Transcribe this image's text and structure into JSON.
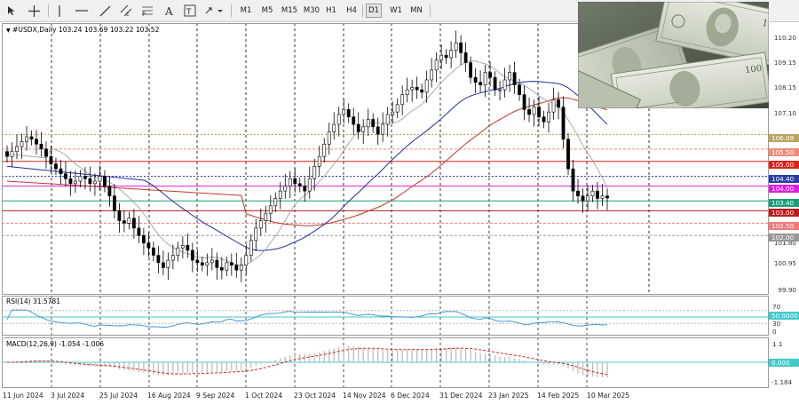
{
  "toolbar": {
    "timeframes": [
      "M1",
      "M5",
      "M15",
      "M30",
      "H1",
      "H4",
      "D1",
      "W1",
      "MN"
    ],
    "active_timeframe": "D1"
  },
  "chart": {
    "title": "#USDX,Daily  103.24 103.69 103.22 103.52",
    "symbol": "#USDX",
    "period": "Daily",
    "open": 103.24,
    "high": 103.69,
    "low": 103.22,
    "close": 103.52
  },
  "price_axis": {
    "ticks": [
      "110.20",
      "109.15",
      "108.15",
      "107.10",
      "101.80",
      "100.95",
      "99.90"
    ],
    "levels": [
      {
        "value": 106.09,
        "label": "106.09",
        "color": "#b9a55e"
      },
      {
        "value": 105.5,
        "label": "105.50",
        "color": "#f08c7c"
      },
      {
        "value": 105.0,
        "label": "105.00",
        "color": "#d9231e"
      },
      {
        "value": 104.4,
        "label": "104.40",
        "color": "#2b3fa3"
      },
      {
        "value": 104.0,
        "label": "104.00",
        "color": "#e01ee0"
      },
      {
        "value": 103.4,
        "label": "103.40",
        "color": "#1b9e77"
      },
      {
        "value": 103.0,
        "label": "103.00",
        "color": "#b81c1c"
      },
      {
        "value": 102.5,
        "label": "102.50",
        "color": "#f07a7a"
      },
      {
        "value": 102.0,
        "label": "102.00",
        "color": "#999999"
      }
    ]
  },
  "rsi": {
    "title": "RSI(14) 31.5781",
    "ticks": [
      "70",
      "30",
      "0"
    ],
    "tag": "50.0000"
  },
  "macd": {
    "title": "MACD(12,26,9) -1.054 -1.006",
    "ticks": [
      "1.1",
      "-1.184"
    ],
    "tag": "0.000"
  },
  "x_axis": {
    "labels": [
      "11 Jun 2024",
      "3 Jul 2024",
      "25 Jul 2024",
      "16 Aug 2024",
      "9 Sep 2024",
      "1 Oct 2024",
      "23 Oct 2024",
      "14 Nov 2024",
      "6 Dec 2024",
      "31 Dec 2024",
      "23 Jan 2025",
      "14 Feb 2025",
      "10 Mar 2025"
    ]
  },
  "chart_data": {
    "type": "candlestick",
    "symbol": "#USDX",
    "timeframe": "Daily",
    "ylim": [
      99.6,
      110.6
    ],
    "closes": [
      105.2,
      105.4,
      105.6,
      105.8,
      106.0,
      105.9,
      105.7,
      105.5,
      105.2,
      104.9,
      104.7,
      104.5,
      104.3,
      104.1,
      104.2,
      104.4,
      104.3,
      104.1,
      104.2,
      104.4,
      104.0,
      103.6,
      103.0,
      102.6,
      102.5,
      102.7,
      102.3,
      102.0,
      101.7,
      101.5,
      101.2,
      100.9,
      100.7,
      101.0,
      101.2,
      101.5,
      101.6,
      101.4,
      101.0,
      100.9,
      100.8,
      100.9,
      101.0,
      100.7,
      100.6,
      100.9,
      100.8,
      100.6,
      100.8,
      101.2,
      101.8,
      102.3,
      102.6,
      102.9,
      103.2,
      103.5,
      103.8,
      104.0,
      104.3,
      104.1,
      104.0,
      103.8,
      104.3,
      104.8,
      105.2,
      105.7,
      106.2,
      106.5,
      106.9,
      107.1,
      106.8,
      106.5,
      106.2,
      106.4,
      106.7,
      106.4,
      106.1,
      106.5,
      106.9,
      107.0,
      107.3,
      107.7,
      107.9,
      108.0,
      107.9,
      107.8,
      108.3,
      108.7,
      109.1,
      109.3,
      109.2,
      109.5,
      109.8,
      109.4,
      109.0,
      108.4,
      108.2,
      108.1,
      108.6,
      108.4,
      107.9,
      107.9,
      108.3,
      108.6,
      108.1,
      107.7,
      107.1,
      106.9,
      107.2,
      106.8,
      106.6,
      107.0,
      107.5,
      107.2,
      105.9,
      104.7,
      103.8,
      103.6,
      103.4,
      103.6,
      103.8,
      103.5,
      103.6,
      103.52
    ],
    "levels": [
      106.09,
      105.5,
      105.0,
      104.4,
      104.0,
      103.4,
      103.0,
      102.5,
      102.0
    ],
    "rsi_last": 31.5781,
    "rsi_levels": [
      70,
      50,
      30
    ],
    "macd_main": -1.054,
    "macd_signal": -1.006,
    "macd_range": [
      -1.184,
      1.1
    ]
  },
  "photo": {
    "subject": "stacks of US dollar banknotes"
  }
}
